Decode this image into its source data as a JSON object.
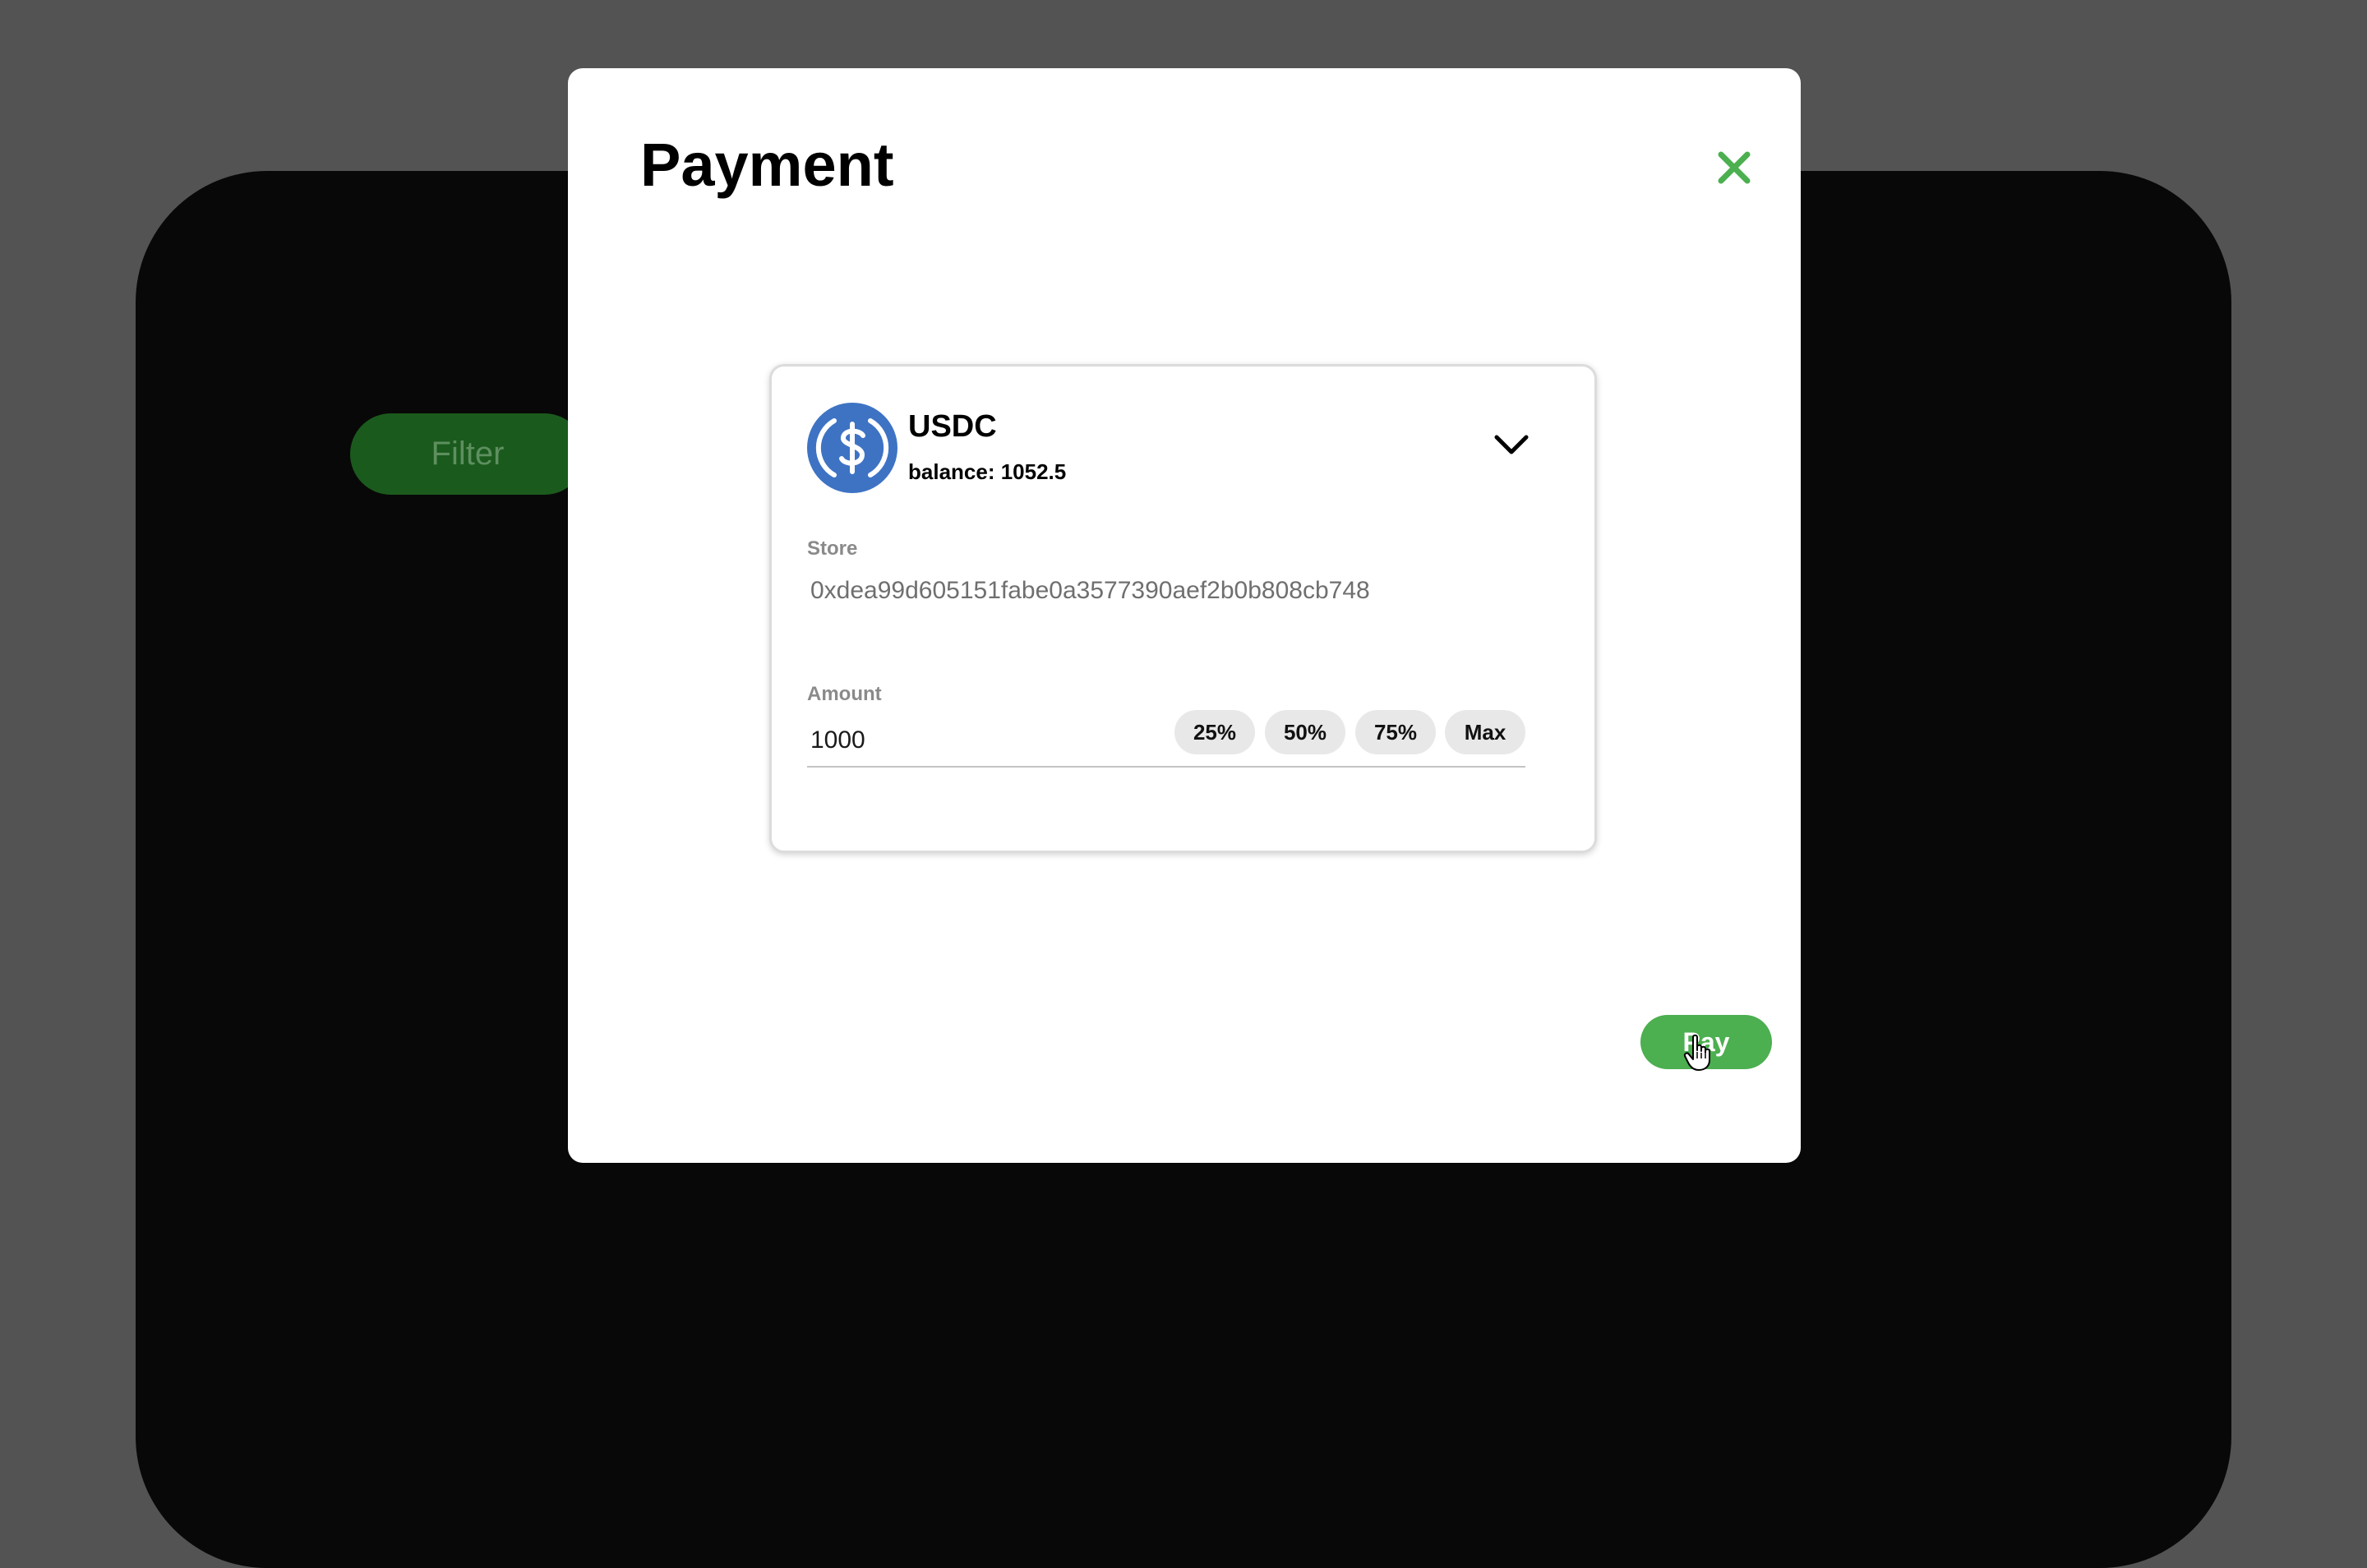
{
  "background": {
    "filter_label": "Filter"
  },
  "modal": {
    "title": "Payment",
    "close_icon": "close-icon"
  },
  "token": {
    "name": "USDC",
    "balance": "balance: 1052.5",
    "logo_icon": "usdc-logo-icon",
    "dropdown_icon": "chevron-down-icon"
  },
  "store": {
    "label": "Store",
    "value": "0xdea99d605151fabe0a3577390aef2b0b808cb748"
  },
  "amount": {
    "label": "Amount",
    "value": "1000",
    "presets": [
      "25%",
      "50%",
      "75%",
      "Max"
    ]
  },
  "actions": {
    "pay_label": "Pay"
  },
  "colors": {
    "accent": "#4caf50",
    "usdc_blue": "#3e73c4",
    "overlay": "#535353"
  }
}
